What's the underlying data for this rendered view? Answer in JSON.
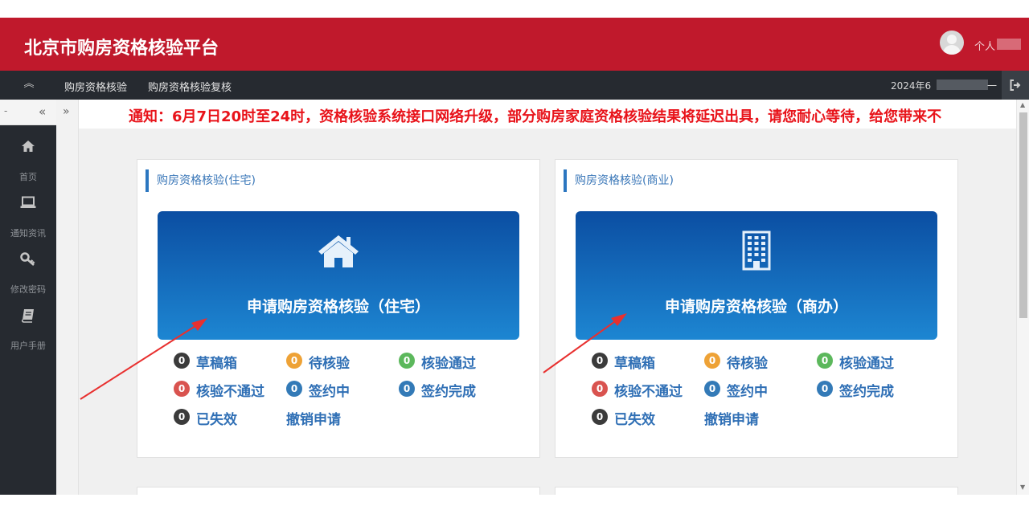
{
  "app": {
    "title": "北京市购房资格核验平台"
  },
  "header": {
    "user_label": "个人"
  },
  "nav": {
    "items": [
      "购房资格核验",
      "购房资格核验复核"
    ],
    "date": "2024年6",
    "dash": "一"
  },
  "sidebar": {
    "top_dash": "-",
    "items": [
      {
        "label": "首页",
        "icon": "home-icon"
      },
      {
        "label": "通知资讯",
        "icon": "laptop-icon"
      },
      {
        "label": "修改密码",
        "icon": "key-icon"
      },
      {
        "label": "用户手册",
        "icon": "book-icon"
      }
    ]
  },
  "notice": {
    "text": "通知：6月7日20时至24时，资格核验系统接口网络升级，部分购房家庭资格核验结果将延迟出具，请您耐心等待，给您带来不"
  },
  "cards": [
    {
      "title": "购房资格核验(住宅)",
      "apply_label": "申请购房资格核验（住宅）",
      "icon": "house-icon",
      "statuses": [
        {
          "count": "0",
          "label": "草稿箱"
        },
        {
          "count": "0",
          "label": "待核验"
        },
        {
          "count": "0",
          "label": "核验通过"
        },
        {
          "count": "0",
          "label": "核验不通过"
        },
        {
          "count": "0",
          "label": "签约中"
        },
        {
          "count": "0",
          "label": "签约完成"
        },
        {
          "count": "0",
          "label": "已失效"
        }
      ],
      "revoke_label": "撤销申请"
    },
    {
      "title": "购房资格核验(商业)",
      "apply_label": "申请购房资格核验（商办）",
      "icon": "building-icon",
      "statuses": [
        {
          "count": "0",
          "label": "草稿箱"
        },
        {
          "count": "0",
          "label": "待核验"
        },
        {
          "count": "0",
          "label": "核验通过"
        },
        {
          "count": "0",
          "label": "核验不通过"
        },
        {
          "count": "0",
          "label": "签约中"
        },
        {
          "count": "0",
          "label": "签约完成"
        },
        {
          "count": "0",
          "label": "已失效"
        }
      ],
      "revoke_label": "撤销申请"
    }
  ],
  "colors": {
    "header_red": "#c0192c",
    "dark_nav": "#262a30",
    "notice_red": "#e8131a",
    "link_blue": "#2f6fb5",
    "badge_draft": "#3b3b3b",
    "badge_pending": "#eea236",
    "badge_pass": "#5cb85c",
    "badge_fail": "#d9534f",
    "badge_signing": "#337ab7",
    "annotation_arrow": "#e8302f"
  }
}
